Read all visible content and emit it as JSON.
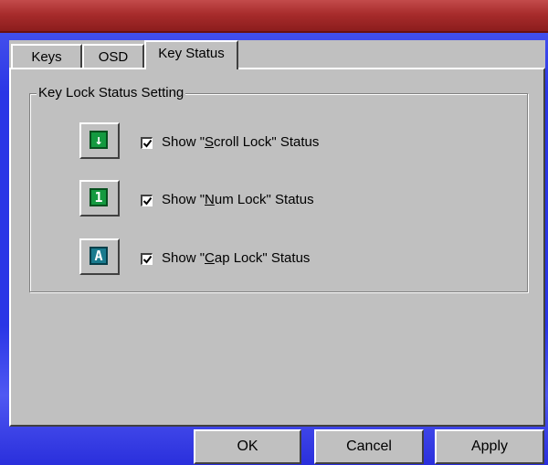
{
  "tabs": [
    {
      "label": "Keys",
      "active": false
    },
    {
      "label": "OSD",
      "active": false
    },
    {
      "label": "Key Status",
      "active": true
    }
  ],
  "group": {
    "legend": "Key Lock Status Setting"
  },
  "options": [
    {
      "icon": "scroll-lock-icon",
      "glyph": "↓",
      "prefix": "Show \"",
      "mnemonic": "S",
      "rest": "croll Lock\" Status",
      "checked": true
    },
    {
      "icon": "num-lock-icon",
      "glyph": "1",
      "prefix": "Show \"",
      "mnemonic": "N",
      "rest": "um Lock\" Status",
      "checked": true
    },
    {
      "icon": "caps-lock-icon",
      "glyph": "A",
      "prefix": "Show \"",
      "mnemonic": "C",
      "rest": "ap Lock\" Status",
      "checked": true
    }
  ],
  "buttons": {
    "ok": "OK",
    "cancel": "Cancel",
    "apply": "Apply"
  },
  "colors": {
    "face": "#c0c0c0",
    "titlebar": "#a82c2c",
    "backdrop": "#2a36e6"
  }
}
